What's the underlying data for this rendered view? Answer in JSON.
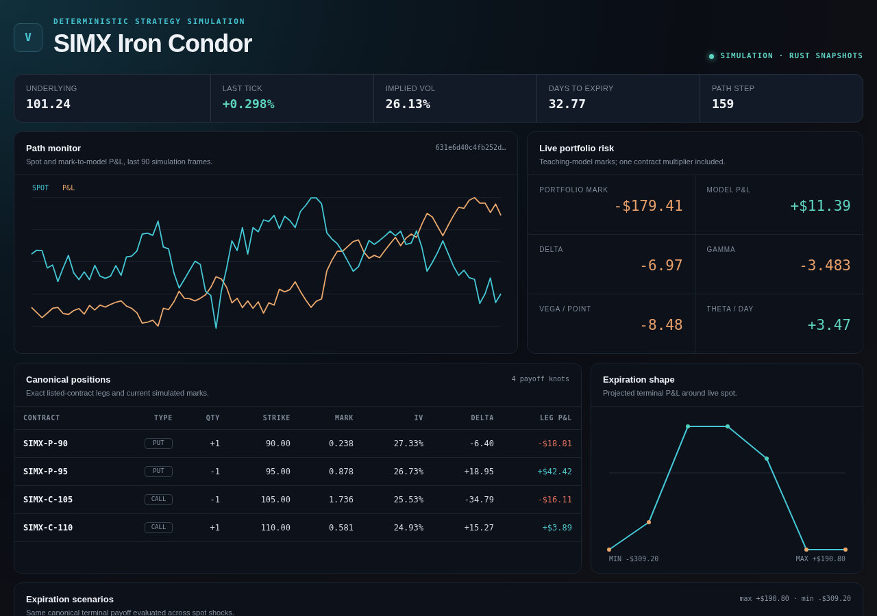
{
  "header": {
    "logo": "V",
    "kicker": "DETERMINISTIC STRATEGY SIMULATION",
    "title": "SIMX Iron Condor",
    "status": "SIMULATION · RUST SNAPSHOTS"
  },
  "stats": [
    {
      "label": "UNDERLYING",
      "value": "101.24",
      "positive": false
    },
    {
      "label": "LAST TICK",
      "value": "+0.298%",
      "positive": true
    },
    {
      "label": "IMPLIED VOL",
      "value": "26.13%",
      "positive": false
    },
    {
      "label": "DAYS TO EXPIRY",
      "value": "32.77",
      "positive": false
    },
    {
      "label": "PATH STEP",
      "value": "159",
      "positive": false
    }
  ],
  "path_monitor": {
    "title": "Path monitor",
    "subtitle": "Spot and mark-to-model P&L, last 90 simulation frames.",
    "hash": "631e6d40c4fb252d…",
    "legend": [
      {
        "label": "SPOT",
        "color": "#45c8d6"
      },
      {
        "label": "P&L",
        "color": "#e9a76c"
      }
    ]
  },
  "risk": {
    "title": "Live portfolio risk",
    "subtitle": "Teaching-model marks; one contract multiplier included.",
    "metrics": [
      {
        "label": "PORTFOLIO MARK",
        "value": "-$179.41",
        "negative": true
      },
      {
        "label": "MODEL P&L",
        "value": "+$11.39",
        "negative": false
      },
      {
        "label": "DELTA",
        "value": "-6.97",
        "negative": true
      },
      {
        "label": "GAMMA",
        "value": "-3.483",
        "negative": true
      },
      {
        "label": "VEGA / POINT",
        "value": "-8.48",
        "negative": true
      },
      {
        "label": "THETA / DAY",
        "value": "+3.47",
        "negative": false
      }
    ]
  },
  "positions": {
    "title": "Canonical positions",
    "subtitle": "Exact listed-contract legs and current simulated marks.",
    "note": "4 payoff knots",
    "columns": [
      "CONTRACT",
      "TYPE",
      "QTY",
      "STRIKE",
      "MARK",
      "IV",
      "DELTA",
      "LEG P&L"
    ],
    "rows": [
      {
        "contract": "SIMX-P-90",
        "type": "PUT",
        "qty": "+1",
        "strike": "90.00",
        "mark": "0.238",
        "iv": "27.33%",
        "delta": "-6.40",
        "leg_pnl": "-$18.81",
        "negative": true
      },
      {
        "contract": "SIMX-P-95",
        "type": "PUT",
        "qty": "-1",
        "strike": "95.00",
        "mark": "0.878",
        "iv": "26.73%",
        "delta": "+18.95",
        "leg_pnl": "+$42.42",
        "negative": false
      },
      {
        "contract": "SIMX-C-105",
        "type": "CALL",
        "qty": "-1",
        "strike": "105.00",
        "mark": "1.736",
        "iv": "25.53%",
        "delta": "-34.79",
        "leg_pnl": "-$16.11",
        "negative": true
      },
      {
        "contract": "SIMX-C-110",
        "type": "CALL",
        "qty": "+1",
        "strike": "110.00",
        "mark": "0.581",
        "iv": "24.93%",
        "delta": "+15.27",
        "leg_pnl": "+$3.89",
        "negative": false
      }
    ]
  },
  "expiration_shape": {
    "title": "Expiration shape",
    "subtitle": "Projected terminal P&L around live spot.",
    "min_label": "MIN -$309.20",
    "max_label": "MAX +$190.80"
  },
  "scenarios": {
    "title": "Expiration scenarios",
    "subtitle": "Same canonical terminal payoff evaluated across spot shocks.",
    "range": "max +$190.80 · min -$309.20"
  }
}
